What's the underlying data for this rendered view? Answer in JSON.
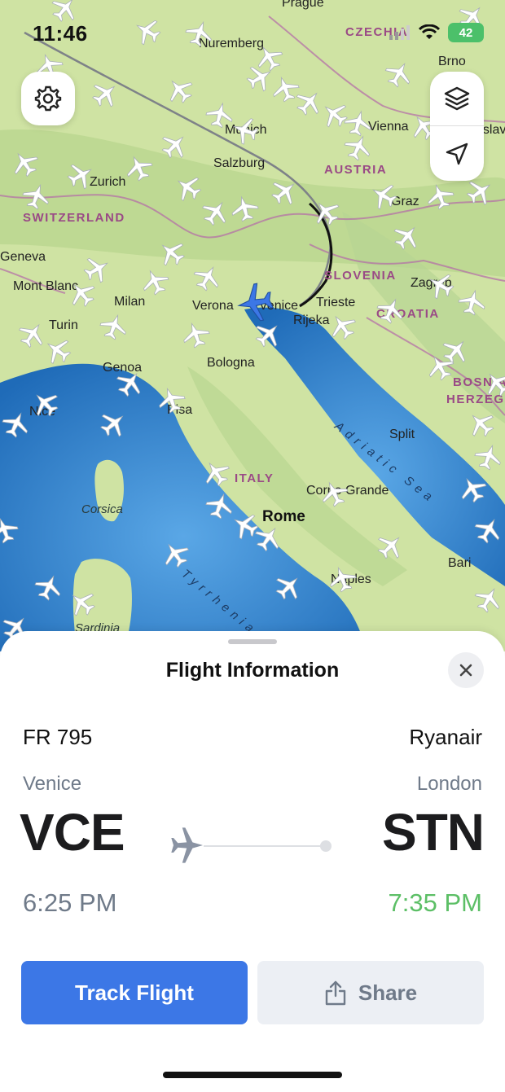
{
  "status": {
    "time": "11:46",
    "battery": "42"
  },
  "map": {
    "countries": [
      "CZECHIA",
      "AUSTRIA",
      "SWITZERLAND",
      "SLOVENIA",
      "CROATIA",
      "BOSNIA",
      "HERZEG",
      "ITALY"
    ],
    "cities": [
      "Prague",
      "Brno",
      "Nuremberg",
      "Vienna",
      "Bratislava",
      "Munich",
      "Salzburg",
      "Zurich",
      "Graz",
      "Geneva",
      "Mont Blanc",
      "Milan",
      "Verona",
      "Venice",
      "Trieste",
      "Zagreb",
      "Rijeka",
      "Turin",
      "Genoa",
      "Bologna",
      "Nice",
      "Pisa",
      "Split",
      "Corno Grande",
      "Rome",
      "Corsica",
      "Bari",
      "Naples",
      "Sardinia",
      "Adriatic Sea",
      "Tyrrhenian"
    ]
  },
  "sheet": {
    "title": "Flight Information",
    "flight_number": "FR 795",
    "airline": "Ryanair",
    "origin": {
      "city": "Venice",
      "code": "VCE",
      "time": "6:25 PM"
    },
    "destination": {
      "city": "London",
      "code": "STN",
      "time": "7:35 PM"
    },
    "track_label": "Track Flight",
    "share_label": "Share"
  },
  "colors": {
    "primary": "#3c77e6",
    "arrival": "#5cbf66",
    "muted": "#6f7a89",
    "sea": "#2f7fc9",
    "land": "#cfe6a0"
  }
}
